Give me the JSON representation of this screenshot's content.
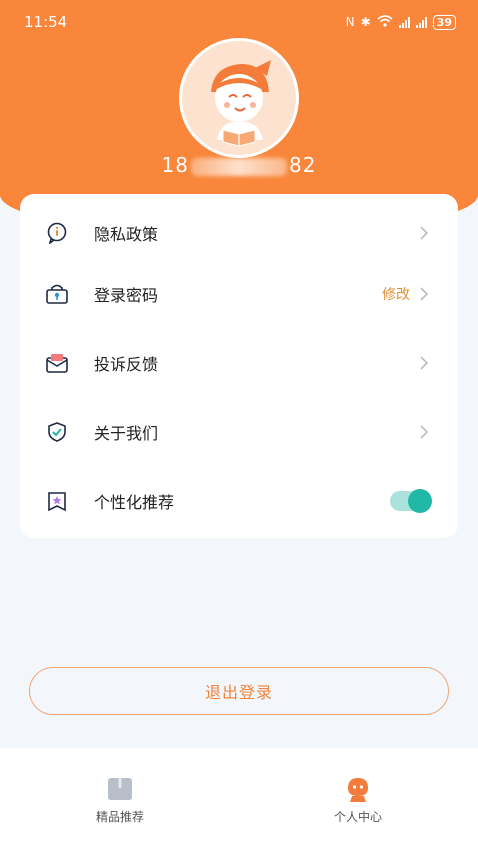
{
  "status_bar": {
    "time": "11:54",
    "battery": "39"
  },
  "profile": {
    "phone_prefix": "18",
    "phone_suffix": "82"
  },
  "menu": {
    "privacy": {
      "label": "隐私政策"
    },
    "password": {
      "label": "登录密码",
      "action": "修改"
    },
    "feedback": {
      "label": "投诉反馈"
    },
    "about": {
      "label": "关于我们"
    },
    "personalized": {
      "label": "个性化推荐",
      "enabled": true
    }
  },
  "logout_label": "退出登录",
  "tabbar": {
    "items": [
      {
        "label": "精品推荐",
        "icon": "book-icon",
        "active": false
      },
      {
        "label": "个人中心",
        "icon": "mascot-icon",
        "active": true
      }
    ]
  },
  "colors": {
    "primary": "#f9863a",
    "toggle": "#21b9a6",
    "background": "#f3f6fb"
  }
}
